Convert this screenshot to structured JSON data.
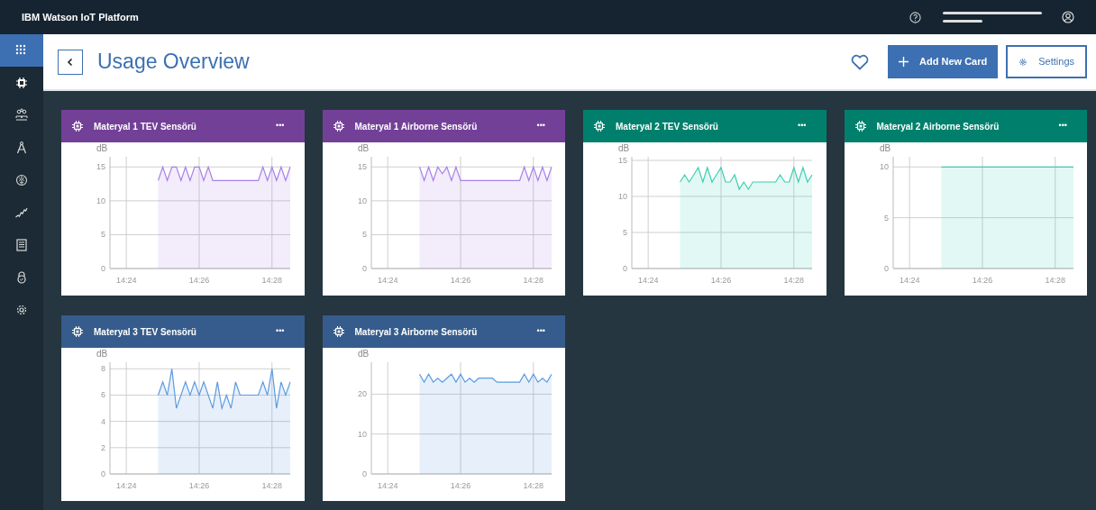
{
  "header": {
    "title": "IBM Watson IoT Platform"
  },
  "sidebar": {
    "items": [
      {
        "selected": true
      },
      {
        "selected": false
      },
      {
        "selected": false
      },
      {
        "selected": false
      },
      {
        "selected": false
      },
      {
        "selected": false
      },
      {
        "selected": false
      },
      {
        "selected": false
      },
      {
        "selected": false
      }
    ]
  },
  "page": {
    "title": "Usage Overview",
    "buttons": [
      {
        "kind": "primary",
        "label": "Add New Card"
      },
      {
        "kind": "secondary",
        "label": "Settings"
      }
    ]
  },
  "cards": [
    {
      "title": "Materyal 1 TEV Sensörü",
      "color": "#734098",
      "menu": "•••",
      "chart_data": {
        "type": "area",
        "grid": true,
        "ylabel": "dB",
        "categories": [
          null,
          null,
          null,
          "14:24",
          null,
          null,
          null,
          null,
          null,
          null,
          null,
          null,
          null,
          null,
          null,
          null,
          null,
          null,
          null,
          "14:26",
          null,
          null,
          null,
          null,
          null,
          null,
          null,
          null,
          null,
          null,
          null,
          null,
          null,
          null,
          null,
          "14:28",
          null,
          null,
          null,
          null
        ],
        "series": [
          {
            "color": "#a882e6",
            "values": [
              null,
              null,
              null,
              null,
              null,
              null,
              null,
              null,
              null,
              null,
              13,
              15,
              13,
              15,
              15,
              13,
              15,
              13,
              15,
              15,
              13,
              15,
              13,
              13,
              13,
              13,
              13,
              13,
              13,
              13,
              13,
              13,
              13,
              15,
              13,
              15,
              13,
              15,
              13,
              15
            ]
          }
        ],
        "ylim": [
          0,
          16.5
        ],
        "yticks": [
          0,
          5,
          10,
          15
        ]
      }
    },
    {
      "title": "Materyal 1 Airborne Sensörü",
      "color": "#734098",
      "menu": "•••",
      "chart_data": {
        "type": "area",
        "grid": true,
        "ylabel": "dB",
        "categories": [
          null,
          null,
          null,
          "14:24",
          null,
          null,
          null,
          null,
          null,
          null,
          null,
          null,
          null,
          null,
          null,
          null,
          null,
          null,
          null,
          "14:26",
          null,
          null,
          null,
          null,
          null,
          null,
          null,
          null,
          null,
          null,
          null,
          null,
          null,
          null,
          null,
          "14:28",
          null,
          null,
          null,
          null
        ],
        "series": [
          {
            "color": "#a882e6",
            "values": [
              null,
              null,
              null,
              null,
              null,
              null,
              null,
              null,
              null,
              null,
              15,
              13,
              15,
              13,
              15,
              14,
              15,
              13,
              15,
              13,
              13,
              13,
              13,
              13,
              13,
              13,
              13,
              13,
              13,
              13,
              13,
              13,
              13,
              15,
              13,
              15,
              13,
              15,
              13,
              15
            ]
          }
        ],
        "ylim": [
          0,
          16.5
        ],
        "yticks": [
          0,
          5,
          10,
          15
        ]
      }
    },
    {
      "title": "Materyal 2 TEV Sensörü",
      "color": "#00806c",
      "menu": "•••",
      "chart_data": {
        "type": "area",
        "grid": true,
        "ylabel": "dB",
        "categories": [
          null,
          null,
          null,
          "14:24",
          null,
          null,
          null,
          null,
          null,
          null,
          null,
          null,
          null,
          null,
          null,
          null,
          null,
          null,
          null,
          "14:26",
          null,
          null,
          null,
          null,
          null,
          null,
          null,
          null,
          null,
          null,
          null,
          null,
          null,
          null,
          null,
          "14:28",
          null,
          null,
          null,
          null
        ],
        "series": [
          {
            "color": "#3ecfb2",
            "values": [
              null,
              null,
              null,
              null,
              null,
              null,
              null,
              null,
              null,
              null,
              12,
              13,
              12,
              13,
              14,
              12,
              14,
              12,
              13,
              14,
              12,
              12,
              13,
              11,
              12,
              11,
              12,
              12,
              12,
              12,
              12,
              12,
              13,
              12,
              12,
              14,
              12,
              14,
              12,
              13
            ]
          }
        ],
        "ylim": [
          0,
          15.5
        ],
        "yticks": [
          0,
          5,
          10,
          15
        ]
      }
    },
    {
      "title": "Materyal 2 Airborne Sensörü",
      "color": "#00806c",
      "menu": "•••",
      "chart_data": {
        "type": "area",
        "grid": true,
        "ylabel": "dB",
        "categories": [
          null,
          null,
          null,
          "14:24",
          null,
          null,
          null,
          null,
          null,
          null,
          null,
          null,
          null,
          null,
          null,
          null,
          null,
          null,
          null,
          "14:26",
          null,
          null,
          null,
          null,
          null,
          null,
          null,
          null,
          null,
          null,
          null,
          null,
          null,
          null,
          null,
          "14:28",
          null,
          null,
          null,
          null
        ],
        "series": [
          {
            "color": "#3ecfb2",
            "values": [
              null,
              null,
              null,
              null,
              null,
              null,
              null,
              null,
              null,
              null,
              10,
              10,
              10,
              10,
              10,
              10,
              10,
              10,
              10,
              10,
              10,
              10,
              10,
              10,
              10,
              10,
              10,
              10,
              10,
              10,
              10,
              10,
              10,
              10,
              10,
              10,
              10,
              10,
              10,
              10
            ]
          }
        ],
        "ylim": [
          0,
          11
        ],
        "yticks": [
          0,
          5,
          10
        ]
      }
    },
    {
      "title": "Materyal 3 TEV Sensörü",
      "color": "#355c8c",
      "menu": "•••",
      "chart_data": {
        "type": "area",
        "grid": true,
        "ylabel": "dB",
        "categories": [
          null,
          null,
          null,
          "14:24",
          null,
          null,
          null,
          null,
          null,
          null,
          null,
          null,
          null,
          null,
          null,
          null,
          null,
          null,
          null,
          "14:26",
          null,
          null,
          null,
          null,
          null,
          null,
          null,
          null,
          null,
          null,
          null,
          null,
          null,
          null,
          null,
          "14:28",
          null,
          null,
          null,
          null
        ],
        "series": [
          {
            "color": "#5b9be0",
            "values": [
              null,
              null,
              null,
              null,
              null,
              null,
              null,
              null,
              null,
              null,
              6,
              7,
              6,
              8,
              5,
              6,
              7,
              6,
              7,
              6,
              7,
              6,
              5,
              7,
              5,
              6,
              5,
              7,
              6,
              6,
              6,
              6,
              6,
              7,
              6,
              8,
              5,
              7,
              6,
              7
            ]
          }
        ],
        "ylim": [
          0,
          8.5
        ],
        "yticks": [
          0,
          2,
          4,
          6,
          8
        ]
      }
    },
    {
      "title": "Materyal 3 Airborne Sensörü",
      "color": "#355c8c",
      "menu": "•••",
      "chart_data": {
        "type": "area",
        "grid": true,
        "ylabel": "dB",
        "categories": [
          null,
          null,
          null,
          "14:24",
          null,
          null,
          null,
          null,
          null,
          null,
          null,
          null,
          null,
          null,
          null,
          null,
          null,
          null,
          null,
          "14:26",
          null,
          null,
          null,
          null,
          null,
          null,
          null,
          null,
          null,
          null,
          null,
          null,
          null,
          null,
          null,
          "14:28",
          null,
          null,
          null,
          null
        ],
        "series": [
          {
            "color": "#5b9be0",
            "values": [
              null,
              null,
              null,
              null,
              null,
              null,
              null,
              null,
              null,
              null,
              25,
              23,
              25,
              23,
              24,
              23,
              24,
              25,
              23,
              25,
              23,
              24,
              23,
              24,
              24,
              24,
              24,
              23,
              23,
              23,
              23,
              23,
              23,
              25,
              23,
              25,
              23,
              24,
              23,
              25
            ]
          }
        ],
        "ylim": [
          0,
          28
        ],
        "yticks": [
          0,
          10,
          20
        ]
      }
    }
  ]
}
